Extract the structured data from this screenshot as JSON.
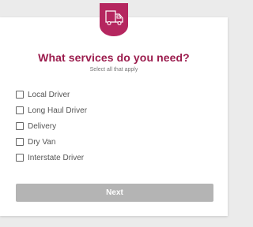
{
  "header": {
    "logo_icon": "truck-icon",
    "accent_color": "#b5265f"
  },
  "main": {
    "title": "What services do you need?",
    "subtitle": "Select all that apply",
    "options": [
      {
        "label": "Local Driver",
        "checked": false
      },
      {
        "label": "Long Haul Driver",
        "checked": false
      },
      {
        "label": "Delivery",
        "checked": false
      },
      {
        "label": "Dry Van",
        "checked": false
      },
      {
        "label": "Interstate Driver",
        "checked": false
      }
    ],
    "next_label": "Next"
  }
}
